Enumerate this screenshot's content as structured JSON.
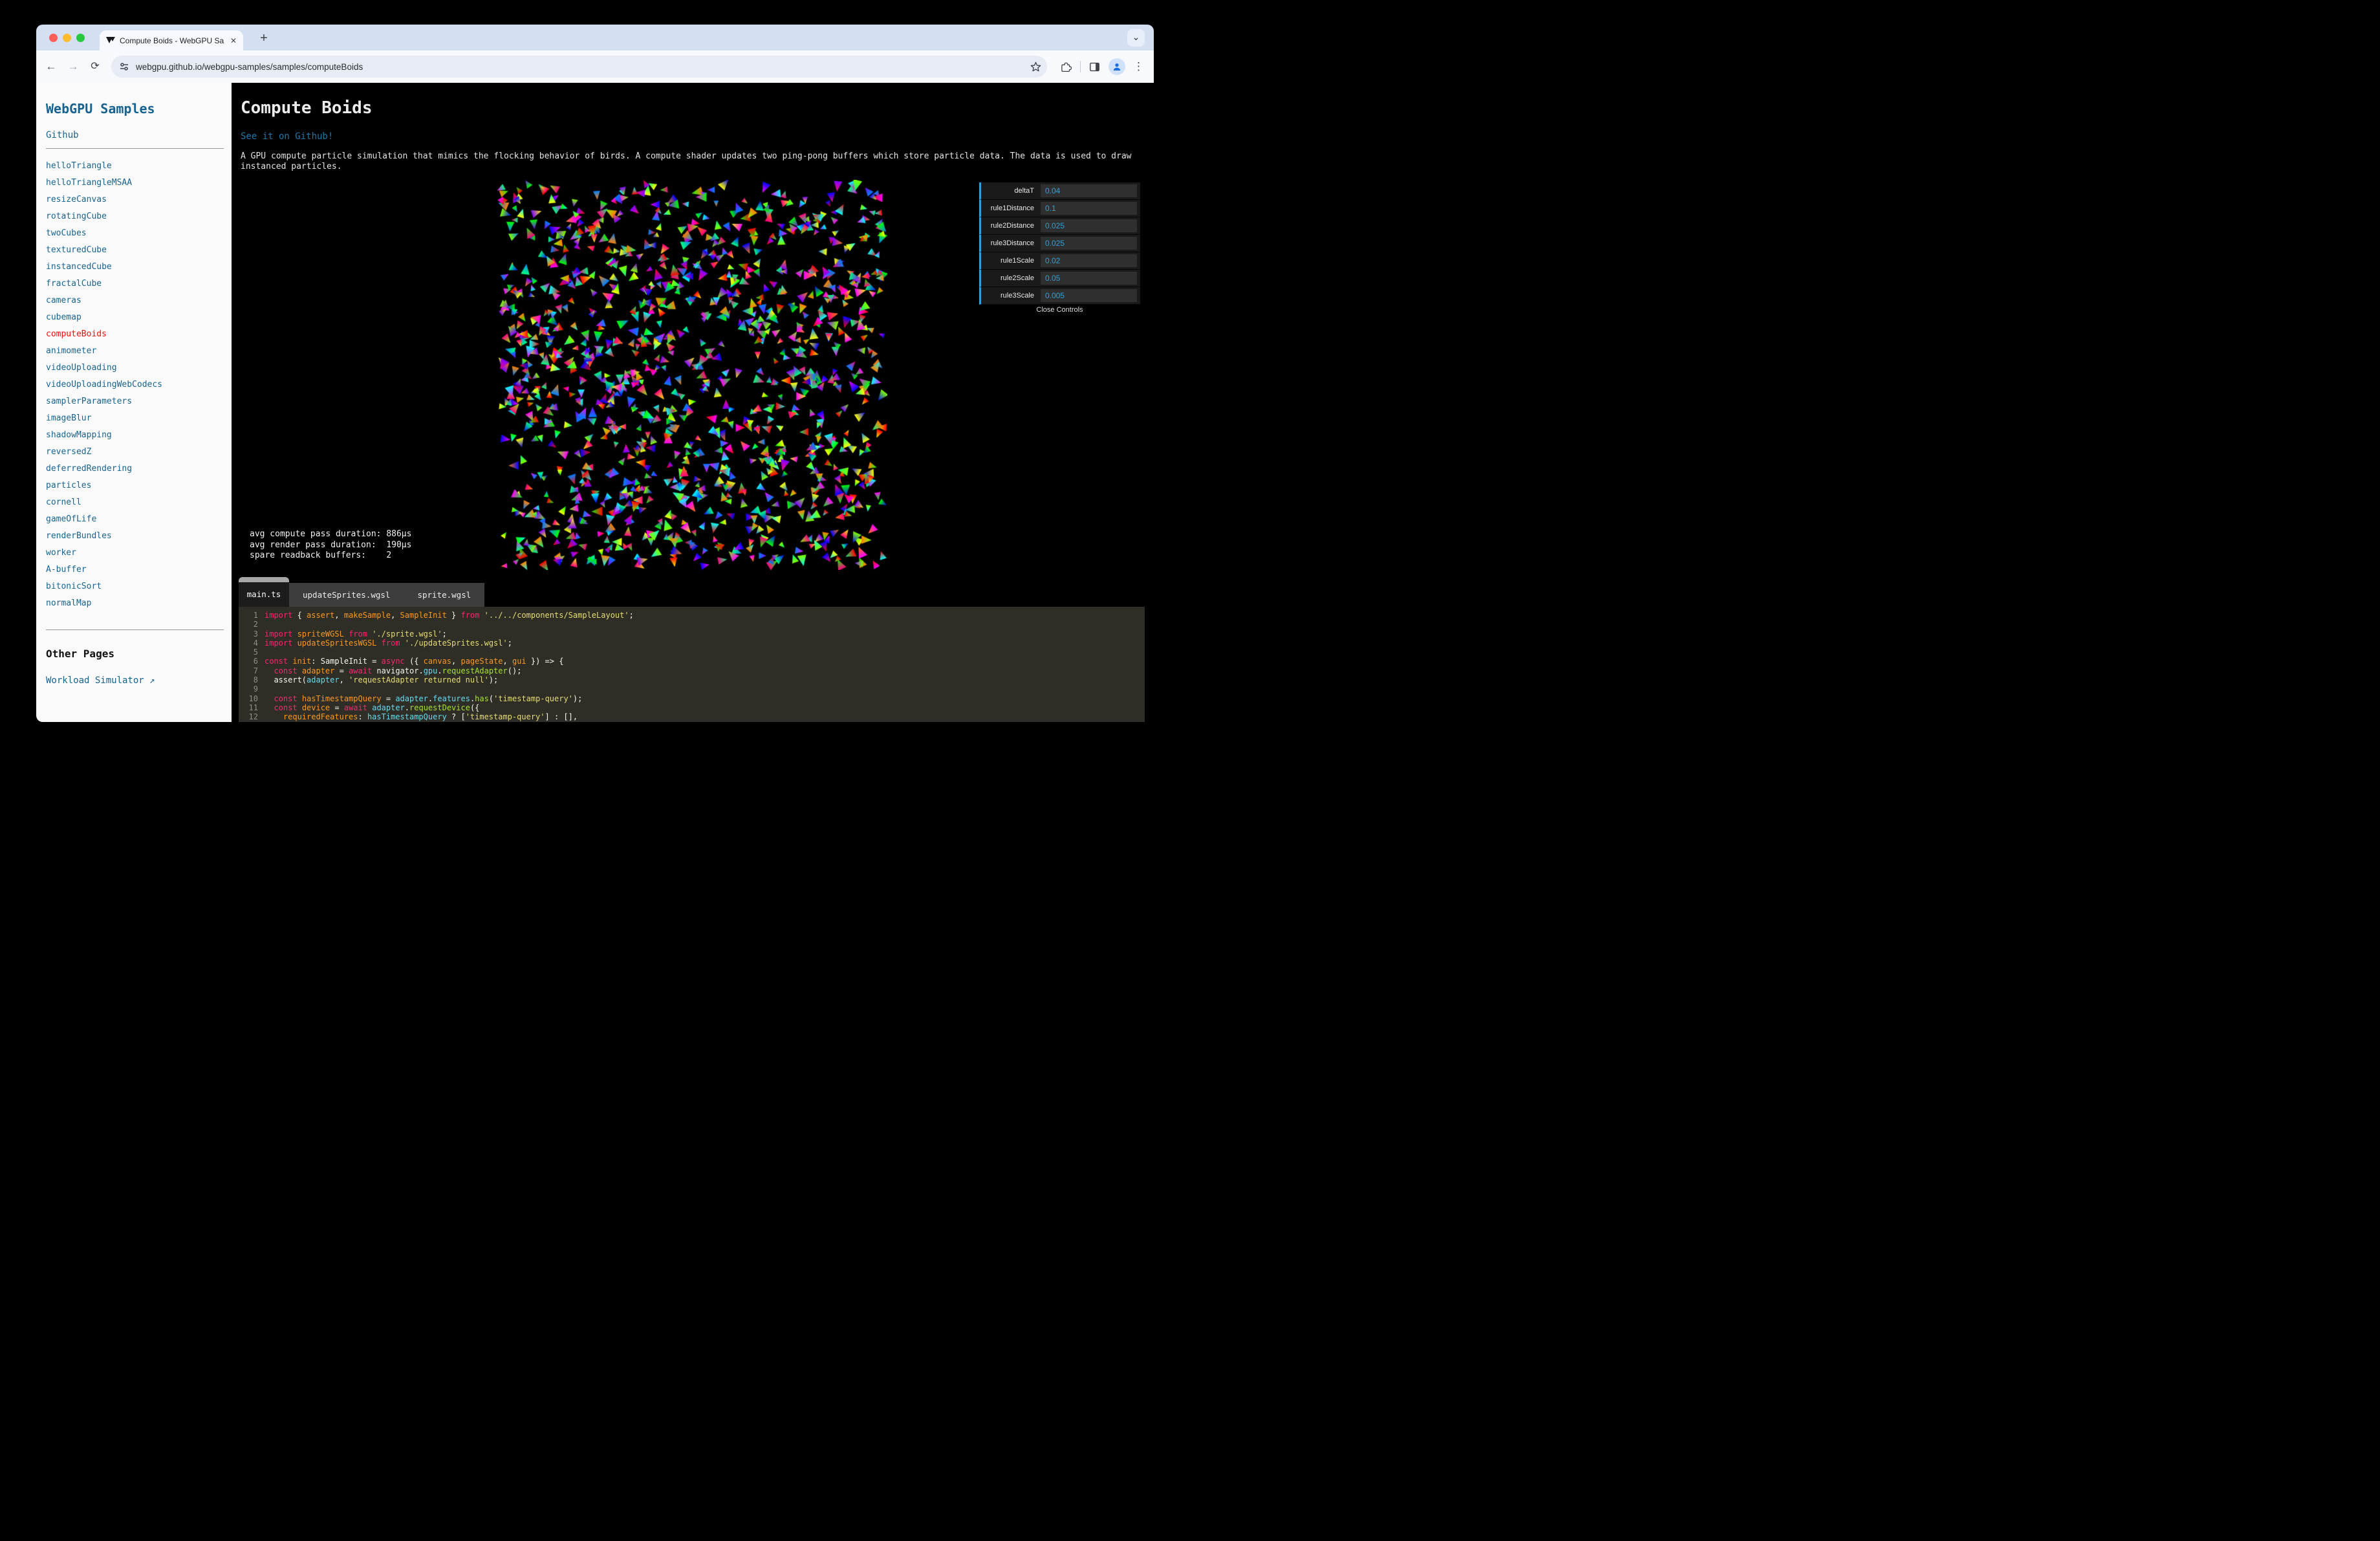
{
  "browser": {
    "tab_title": "Compute Boids - WebGPU Sa",
    "url": "webgpu.github.io/webgpu-samples/samples/computeBoids",
    "traffic_lights": {
      "close": "#ff5f57",
      "minimize": "#febc2e",
      "zoom": "#28c840"
    }
  },
  "sidebar": {
    "title": "WebGPU Samples",
    "github_label": "Github",
    "active_sample": "computeBoids",
    "active_color": "#e8120d",
    "link_color": "#19648f",
    "samples": [
      "helloTriangle",
      "helloTriangleMSAA",
      "resizeCanvas",
      "rotatingCube",
      "twoCubes",
      "texturedCube",
      "instancedCube",
      "fractalCube",
      "cameras",
      "cubemap",
      "computeBoids",
      "animometer",
      "videoUploading",
      "videoUploadingWebCodecs",
      "samplerParameters",
      "imageBlur",
      "shadowMapping",
      "reversedZ",
      "deferredRendering",
      "particles",
      "cornell",
      "gameOfLife",
      "renderBundles",
      "worker",
      "A-buffer",
      "bitonicSort",
      "normalMap"
    ],
    "other_pages_heading": "Other Pages",
    "workload_label": "Workload Simulator ↗"
  },
  "main": {
    "title": "Compute Boids",
    "github_link": "See it on Github!",
    "description": "A GPU compute particle simulation that mimics the flocking behavior of birds. A compute shader updates two ping-pong buffers which store particle data. The data is used to draw instanced particles.",
    "stats_lines": [
      "avg compute pass duration: 886µs",
      "avg render pass duration:  190µs",
      "spare readback buffers:    2"
    ],
    "simulation": {
      "boid_count": 1150,
      "seed": 12,
      "canvas_size": 603,
      "background": "#000000"
    }
  },
  "gui": {
    "accent": "#2FA1D6",
    "controls": [
      {
        "label": "deltaT",
        "value": "0.04"
      },
      {
        "label": "rule1Distance",
        "value": "0.1"
      },
      {
        "label": "rule2Distance",
        "value": "0.025"
      },
      {
        "label": "rule3Distance",
        "value": "0.025"
      },
      {
        "label": "rule1Scale",
        "value": "0.02"
      },
      {
        "label": "rule2Scale",
        "value": "0.05"
      },
      {
        "label": "rule3Scale",
        "value": "0.005"
      }
    ],
    "close_label": "Close Controls"
  },
  "code": {
    "tabs": [
      {
        "label": "main.ts",
        "active": true
      },
      {
        "label": "updateSprites.wgsl",
        "active": false
      },
      {
        "label": "sprite.wgsl",
        "active": false
      }
    ],
    "lines": [
      [
        {
          "t": "import ",
          "c": "k"
        },
        {
          "t": "{ ",
          "c": "p"
        },
        {
          "t": "assert",
          "c": "i"
        },
        {
          "t": ", ",
          "c": "p"
        },
        {
          "t": "makeSample",
          "c": "i"
        },
        {
          "t": ", ",
          "c": "p"
        },
        {
          "t": "SampleInit",
          "c": "i"
        },
        {
          "t": " } ",
          "c": "p"
        },
        {
          "t": "from",
          "c": "k"
        },
        {
          "t": " ",
          "c": "p"
        },
        {
          "t": "'../../components/SampleLayout'",
          "c": "s"
        },
        {
          "t": ";",
          "c": "p"
        }
      ],
      [],
      [
        {
          "t": "import ",
          "c": "k"
        },
        {
          "t": "spriteWGSL",
          "c": "i"
        },
        {
          "t": " ",
          "c": "p"
        },
        {
          "t": "from",
          "c": "k"
        },
        {
          "t": " ",
          "c": "p"
        },
        {
          "t": "'./sprite.wgsl'",
          "c": "s"
        },
        {
          "t": ";",
          "c": "p"
        }
      ],
      [
        {
          "t": "import ",
          "c": "k"
        },
        {
          "t": "updateSpritesWGSL",
          "c": "i"
        },
        {
          "t": " ",
          "c": "p"
        },
        {
          "t": "from",
          "c": "k"
        },
        {
          "t": " ",
          "c": "p"
        },
        {
          "t": "'./updateSprites.wgsl'",
          "c": "s"
        },
        {
          "t": ";",
          "c": "p"
        }
      ],
      [],
      [
        {
          "t": "const ",
          "c": "k"
        },
        {
          "t": "init",
          "c": "i"
        },
        {
          "t": ": SampleInit = ",
          "c": "p"
        },
        {
          "t": "async",
          "c": "k"
        },
        {
          "t": " ({ ",
          "c": "p"
        },
        {
          "t": "canvas",
          "c": "i"
        },
        {
          "t": ", ",
          "c": "p"
        },
        {
          "t": "pageState",
          "c": "i"
        },
        {
          "t": ", ",
          "c": "p"
        },
        {
          "t": "gui",
          "c": "i"
        },
        {
          "t": " }) => {",
          "c": "p"
        }
      ],
      [
        {
          "t": "  ",
          "c": "p"
        },
        {
          "t": "const ",
          "c": "k"
        },
        {
          "t": "adapter",
          "c": "i"
        },
        {
          "t": " = ",
          "c": "p"
        },
        {
          "t": "await",
          "c": "k"
        },
        {
          "t": " navigator.",
          "c": "p"
        },
        {
          "t": "gpu",
          "c": "o"
        },
        {
          "t": ".",
          "c": "p"
        },
        {
          "t": "requestAdapter",
          "c": "f"
        },
        {
          "t": "();",
          "c": "p"
        }
      ],
      [
        {
          "t": "  assert(",
          "c": "p"
        },
        {
          "t": "adapter",
          "c": "o"
        },
        {
          "t": ", ",
          "c": "p"
        },
        {
          "t": "'requestAdapter returned null'",
          "c": "s"
        },
        {
          "t": ");",
          "c": "p"
        }
      ],
      [],
      [
        {
          "t": "  ",
          "c": "p"
        },
        {
          "t": "const ",
          "c": "k"
        },
        {
          "t": "hasTimestampQuery",
          "c": "i"
        },
        {
          "t": " = ",
          "c": "p"
        },
        {
          "t": "adapter",
          "c": "o"
        },
        {
          "t": ".",
          "c": "p"
        },
        {
          "t": "features",
          "c": "o"
        },
        {
          "t": ".",
          "c": "p"
        },
        {
          "t": "has",
          "c": "f"
        },
        {
          "t": "(",
          "c": "p"
        },
        {
          "t": "'timestamp-query'",
          "c": "s"
        },
        {
          "t": ");",
          "c": "p"
        }
      ],
      [
        {
          "t": "  ",
          "c": "p"
        },
        {
          "t": "const ",
          "c": "k"
        },
        {
          "t": "device",
          "c": "i"
        },
        {
          "t": " = ",
          "c": "p"
        },
        {
          "t": "await",
          "c": "k"
        },
        {
          "t": " ",
          "c": "p"
        },
        {
          "t": "adapter",
          "c": "o"
        },
        {
          "t": ".",
          "c": "p"
        },
        {
          "t": "requestDevice",
          "c": "f"
        },
        {
          "t": "({",
          "c": "p"
        }
      ],
      [
        {
          "t": "    ",
          "c": "p"
        },
        {
          "t": "requiredFeatures",
          "c": "i"
        },
        {
          "t": ": ",
          "c": "p"
        },
        {
          "t": "hasTimestampQuery",
          "c": "o"
        },
        {
          "t": " ? [",
          "c": "p"
        },
        {
          "t": "'timestamp-query'",
          "c": "s"
        },
        {
          "t": "] : [],",
          "c": "p"
        }
      ]
    ]
  }
}
